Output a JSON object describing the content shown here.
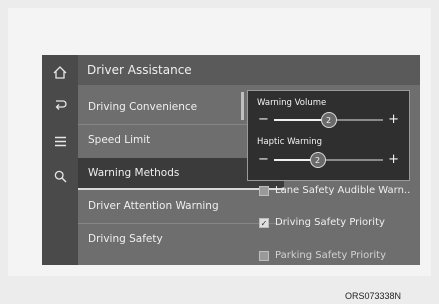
{
  "header": {
    "title": "Driver Assistance"
  },
  "rail_icons": [
    "home-icon",
    "back-icon",
    "menu-icon",
    "search-icon"
  ],
  "menu": [
    {
      "label": "Driving Convenience",
      "selected": false
    },
    {
      "label": "Speed Limit",
      "selected": false
    },
    {
      "label": "Warning Methods",
      "selected": true
    },
    {
      "label": "Driver Attention Warning",
      "selected": false
    },
    {
      "label": "Driving Safety",
      "selected": false
    }
  ],
  "popup": {
    "warning_volume": {
      "label": "Warning Volume",
      "value": "2",
      "minus": "−",
      "plus": "+"
    },
    "haptic_warning": {
      "label": "Haptic Warning",
      "value": "2",
      "minus": "−",
      "plus": "+"
    }
  },
  "options": [
    {
      "label": "Lane Safety Audible Warn..",
      "checked": false
    },
    {
      "label": "Driving Safety Priority",
      "checked": true,
      "check_glyph": "✓"
    },
    {
      "label": "Parking Safety Priority",
      "checked": false
    }
  ],
  "image_code": "ORS073338N"
}
